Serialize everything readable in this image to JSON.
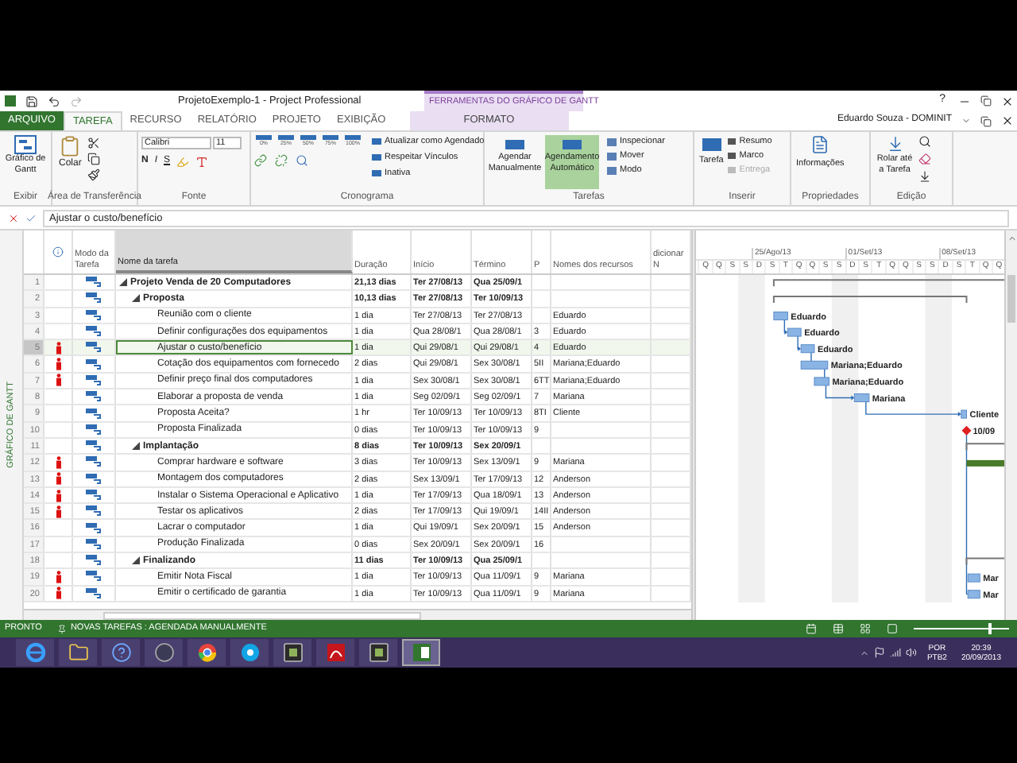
{
  "title_bar": {
    "title": "ProjetoExemplo-1 - Project Professional",
    "context_label": "FERRAMENTAS DO GRÁFICO DE GANTT",
    "help": "?"
  },
  "ribbon_tabs": [
    {
      "label": "ARQUIVO",
      "kind": "file",
      "selected": false
    },
    {
      "label": "TAREFA",
      "kind": "tab",
      "selected": true
    },
    {
      "label": "RECURSO",
      "kind": "tab",
      "selected": false
    },
    {
      "label": "RELATÓRIO",
      "kind": "tab",
      "selected": false
    },
    {
      "label": "PROJETO",
      "kind": "tab",
      "selected": false
    },
    {
      "label": "EXIBIÇÃO",
      "kind": "tab",
      "selected": false
    },
    {
      "label": "FORMATO",
      "kind": "context",
      "selected": false
    }
  ],
  "user": "Eduardo Souza - DOMINIT",
  "ribbon": {
    "view": {
      "button": "Gráfico de Gantt",
      "group": "Exibir"
    },
    "clipboard": {
      "paste": "Colar",
      "group": "Área de Transferência"
    },
    "font": {
      "family": "Calibri",
      "size": "11",
      "bold": "N",
      "italic": "I",
      "underline": "S",
      "group": "Fonte"
    },
    "schedule": {
      "percent_buttons": [
        "0%",
        "25%",
        "50%",
        "75%",
        "100%"
      ],
      "commands": [
        "Atualizar como Agendado",
        "Respeitar Vínculos",
        "Inativa"
      ],
      "group": "Cronograma"
    },
    "tasks": {
      "mode_buttons": [
        {
          "label": "Agendar Manualmente",
          "selected": false
        },
        {
          "label": "Agendamento Automático",
          "selected": true
        }
      ],
      "commands": [
        "Inspecionar",
        "Mover",
        "Modo"
      ],
      "group": "Tarefas"
    },
    "insert": {
      "button": "Tarefa",
      "commands": [
        {
          "label": "Resumo",
          "disabled": false
        },
        {
          "label": "Marco",
          "disabled": false
        },
        {
          "label": "Entrega",
          "disabled": true
        }
      ],
      "group": "Inserir"
    },
    "properties": {
      "button": "Informações",
      "group": "Propriedades"
    },
    "editing": {
      "button": "Rolar até a Tarefa",
      "group": "Edição"
    }
  },
  "entry_bar": {
    "value": "Ajustar o custo/benefício"
  },
  "side_label": "GRÁFICO DE GANTT",
  "table": {
    "columns": [
      "Modo da Tarefa",
      "Nome da tarefa",
      "Duração",
      "Início",
      "Término",
      "P",
      "Nomes dos recursos",
      "dicionar N"
    ],
    "tasks": [
      {
        "id": "1",
        "name": "Projeto Venda de 20 Computadores",
        "duration": "21,13 dias",
        "start": "Ter 27/08/13",
        "finish": "Qua 25/09/1",
        "expanded": true,
        "selected": false,
        "indicator": false,
        "children": [
          {
            "id": "2",
            "name": "Proposta",
            "duration": "10,13 dias",
            "start": "Ter 27/08/13",
            "finish": "Ter 10/09/13",
            "expanded": true,
            "selected": false,
            "indicator": false,
            "children": [
              {
                "id": "3",
                "name": "Reunião com o cliente",
                "duration": "1 dia",
                "start": "Ter 27/08/13",
                "finish": "Ter 27/08/13",
                "resources": "Eduardo",
                "bar_label": "Eduardo",
                "selected": false,
                "indicator": false
              },
              {
                "id": "4",
                "name": "Definir configurações dos equipamentos",
                "duration": "1 dia",
                "start": "Qua 28/08/1",
                "finish": "Qua 28/08/1",
                "predecessors": "3",
                "resources": "Eduardo",
                "bar_label": "Eduardo",
                "selected": false,
                "indicator": false
              },
              {
                "id": "5",
                "name": "Ajustar o custo/benefício",
                "duration": "1 dia",
                "start": "Qui 29/08/1",
                "finish": "Qui 29/08/1",
                "predecessors": "4",
                "resources": "Eduardo",
                "bar_label": "Eduardo",
                "selected": true,
                "indicator": true
              },
              {
                "id": "6",
                "name": "Cotação dos equipamentos com fornecedo",
                "duration": "2 dias",
                "start": "Qui 29/08/1",
                "finish": "Sex 30/08/1",
                "predecessors": "5II",
                "resources": "Mariana;Eduardo",
                "bar_label": "Mariana;Eduardo",
                "selected": false,
                "indicator": true
              },
              {
                "id": "7",
                "name": "Definir preço final dos computadores",
                "duration": "1 dia",
                "start": "Sex 30/08/1",
                "finish": "Sex 30/08/1",
                "predecessors": "6TT",
                "resources": "Mariana;Eduardo",
                "bar_label": "Mariana;Eduardo",
                "selected": false,
                "indicator": true
              },
              {
                "id": "8",
                "name": "Elaborar a proposta de venda",
                "duration": "1 dia",
                "start": "Seg 02/09/1",
                "finish": "Seg 02/09/1",
                "predecessors": "7",
                "resources": "Mariana",
                "bar_label": "Mariana",
                "selected": false,
                "indicator": false
              },
              {
                "id": "9",
                "name": "Proposta Aceita?",
                "duration": "1 hr",
                "start": "Ter 10/09/13",
                "finish": "Ter 10/09/13",
                "predecessors": "8TI",
                "resources": "Cliente",
                "bar_label": "Cliente",
                "selected": false,
                "indicator": false
              },
              {
                "id": "10",
                "name": "Proposta Finalizada",
                "duration": "0 dias",
                "start": "Ter 10/09/13",
                "finish": "Ter 10/09/13",
                "predecessors": "9",
                "bar_label": "10/09",
                "selected": false,
                "indicator": false
              }
            ]
          },
          {
            "id": "11",
            "name": "Implantação",
            "duration": "8 dias",
            "start": "Ter 10/09/13",
            "finish": "Sex 20/09/1",
            "expanded": true,
            "selected": false,
            "indicator": false,
            "children": [
              {
                "id": "12",
                "name": "Comprar hardware e software",
                "duration": "3 dias",
                "start": "Ter 10/09/13",
                "finish": "Sex 13/09/1",
                "predecessors": "9",
                "resources": "Mariana",
                "selected": false,
                "indicator": true
              },
              {
                "id": "13",
                "name": "Montagem dos computadores",
                "duration": "2 dias",
                "start": "Sex 13/09/1",
                "finish": "Ter 17/09/13",
                "predecessors": "12",
                "resources": "Anderson",
                "selected": false,
                "indicator": true
              },
              {
                "id": "14",
                "name": "Instalar o Sistema Operacional e Aplicativo",
                "duration": "1 dia",
                "start": "Ter 17/09/13",
                "finish": "Qua 18/09/1",
                "predecessors": "13",
                "resources": "Anderson",
                "selected": false,
                "indicator": true
              },
              {
                "id": "15",
                "name": "Testar os aplicativos",
                "duration": "2 dias",
                "start": "Ter 17/09/13",
                "finish": "Qui 19/09/1",
                "predecessors": "14II",
                "resources": "Anderson",
                "selected": false,
                "indicator": true
              },
              {
                "id": "16",
                "name": "Lacrar o computador",
                "duration": "1 dia",
                "start": "Qui 19/09/1",
                "finish": "Sex 20/09/1",
                "predecessors": "15",
                "resources": "Anderson",
                "selected": false,
                "indicator": false
              },
              {
                "id": "17",
                "name": "Produção Finalizada",
                "duration": "0 dias",
                "start": "Sex 20/09/1",
                "finish": "Sex 20/09/1",
                "predecessors": "16",
                "selected": false,
                "indicator": false
              }
            ]
          },
          {
            "id": "18",
            "name": "Finalizando",
            "duration": "11 dias",
            "start": "Ter 10/09/13",
            "finish": "Qua 25/09/1",
            "expanded": true,
            "selected": false,
            "indicator": false,
            "children": [
              {
                "id": "19",
                "name": "Emitir Nota Fiscal",
                "duration": "1 dia",
                "start": "Ter 10/09/13",
                "finish": "Qua 11/09/1",
                "predecessors": "9",
                "resources": "Mariana",
                "bar_label": "Mar",
                "selected": false,
                "indicator": true
              },
              {
                "id": "20",
                "name": "Emitir o certificado de garantia",
                "duration": "1 dia",
                "start": "Ter 10/09/13",
                "finish": "Qua 11/09/1",
                "predecessors": "9",
                "resources": "Mariana",
                "bar_label": "Mar",
                "selected": false,
                "indicator": true
              }
            ]
          }
        ]
      }
    ]
  },
  "gantt": {
    "weeks": [
      "25/Ago/13",
      "01/Set/13",
      "08/Set/13"
    ],
    "days": [
      "Q",
      "Q",
      "S",
      "S",
      "D",
      "S",
      "T",
      "Q",
      "Q",
      "S",
      "S",
      "D",
      "S",
      "T",
      "Q",
      "Q",
      "S",
      "S",
      "D",
      "S",
      "T",
      "Q",
      "Q"
    ]
  },
  "status_bar": {
    "mode": "PRONTO",
    "new_tasks": "NOVAS TAREFAS : AGENDADA MANUALMENTE",
    "zoom": {
      "level": 0.8
    }
  },
  "taskbar": {
    "apps": [
      {
        "kind": "browser",
        "selected": false
      },
      {
        "kind": "folder",
        "selected": false
      },
      {
        "kind": "help",
        "selected": false
      },
      {
        "kind": "sphere",
        "selected": false
      },
      {
        "kind": "round",
        "selected": false
      },
      {
        "kind": "chat",
        "selected": false
      },
      {
        "kind": "app",
        "selected": false
      },
      {
        "kind": "pdf",
        "selected": false
      },
      {
        "kind": "app",
        "selected": false
      },
      {
        "kind": "project",
        "selected": true
      }
    ],
    "language": "POR",
    "layout": "PTB2",
    "time": "20:39",
    "date": "20/09/2013"
  }
}
